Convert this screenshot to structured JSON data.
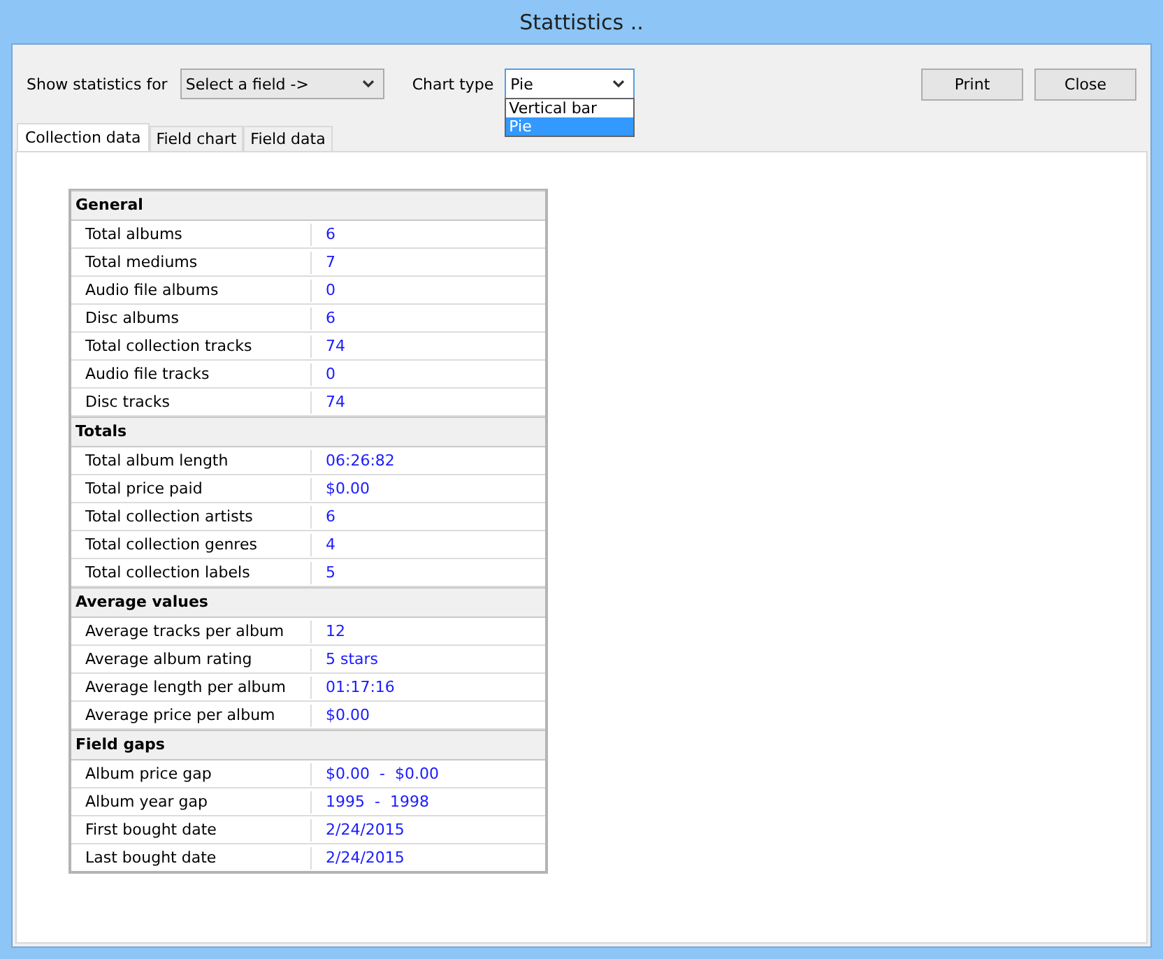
{
  "window": {
    "title": "Stattistics .."
  },
  "toolbar": {
    "field_label": "Show statistics for",
    "field_select": {
      "value": "Select a field ->"
    },
    "chart_label": "Chart type",
    "chart_select": {
      "value": "Pie",
      "expanded": true,
      "options": [
        {
          "label": "Vertical bar",
          "selected": false
        },
        {
          "label": "Pie",
          "selected": true
        }
      ]
    },
    "buttons": [
      "Print",
      "Close"
    ]
  },
  "tabs": [
    {
      "label": "Collection data",
      "selected": true
    },
    {
      "label": "Field chart",
      "selected": false
    },
    {
      "label": "Field data",
      "selected": false
    }
  ],
  "sections": [
    {
      "title": "General",
      "rows": [
        {
          "label": "Total albums",
          "value": "6"
        },
        {
          "label": "Total mediums",
          "value": "7"
        },
        {
          "label": "Audio file albums",
          "value": "0"
        },
        {
          "label": "Disc albums",
          "value": "6"
        },
        {
          "label": "Total collection tracks",
          "value": "74"
        },
        {
          "label": "Audio file tracks",
          "value": "0"
        },
        {
          "label": "Disc tracks",
          "value": "74"
        }
      ]
    },
    {
      "title": "Totals",
      "rows": [
        {
          "label": "Total album length",
          "value": "06:26:82"
        },
        {
          "label": "Total price paid",
          "value": "$0.00"
        },
        {
          "label": "Total collection artists",
          "value": "6"
        },
        {
          "label": "Total collection genres",
          "value": "4"
        },
        {
          "label": "Total collection labels",
          "value": "5"
        }
      ]
    },
    {
      "title": "Average values",
      "rows": [
        {
          "label": "Average tracks per album",
          "value": "12"
        },
        {
          "label": "Average album rating",
          "value": "5 stars"
        },
        {
          "label": "Average length per album",
          "value": "01:17:16"
        },
        {
          "label": "Average price per album",
          "value": "$0.00"
        }
      ]
    },
    {
      "title": "Field gaps",
      "rows": [
        {
          "label": "Album price gap",
          "value": "$0.00  -  $0.00"
        },
        {
          "label": "Album year gap",
          "value": "1995  -  1998"
        },
        {
          "label": "First bought date",
          "value": "2/24/2015"
        },
        {
          "label": "Last bought date",
          "value": "2/24/2015"
        }
      ]
    }
  ]
}
